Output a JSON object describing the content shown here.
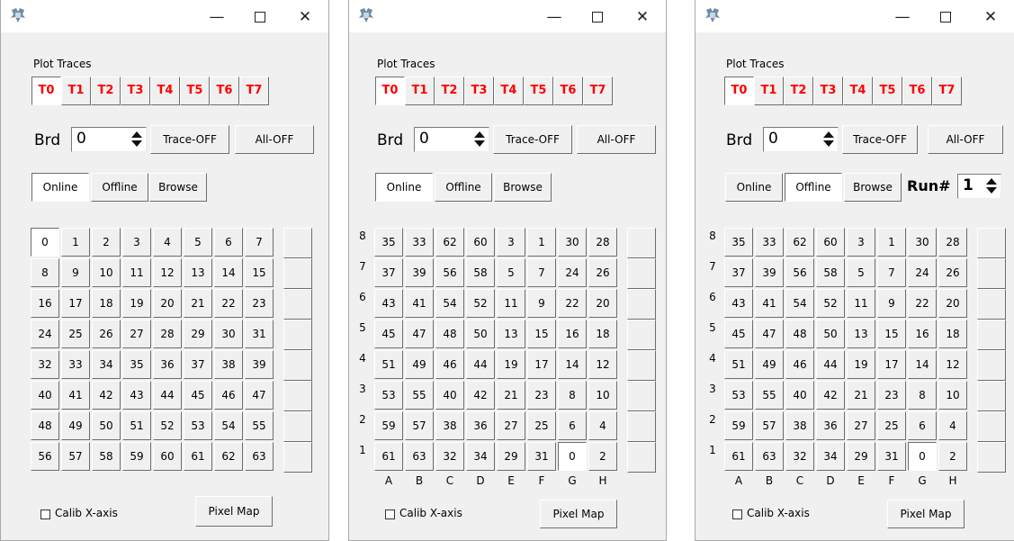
{
  "trace_section": {
    "label": "Plot Traces",
    "traces": [
      "T0",
      "T1",
      "T2",
      "T3",
      "T4",
      "T5",
      "T6",
      "T7"
    ],
    "selected": "T0"
  },
  "brd": {
    "label": "Brd",
    "value": "0"
  },
  "buttons": {
    "trace_off": "Trace-OFF",
    "all_off": "All-OFF",
    "pixel_map": "Pixel Map"
  },
  "modes": [
    "Online",
    "Offline",
    "Browse"
  ],
  "calib": {
    "label": "Calib X-axis",
    "checked": false
  },
  "run": {
    "label": "Run#",
    "value": "1"
  },
  "windows": [
    {
      "mode": "Online",
      "selected_channel": "0",
      "cells": [
        [
          "0",
          "1",
          "2",
          "3",
          "4",
          "5",
          "6",
          "7"
        ],
        [
          "8",
          "9",
          "10",
          "11",
          "12",
          "13",
          "14",
          "15"
        ],
        [
          "16",
          "17",
          "18",
          "19",
          "20",
          "21",
          "22",
          "23"
        ],
        [
          "24",
          "25",
          "26",
          "27",
          "28",
          "29",
          "30",
          "31"
        ],
        [
          "32",
          "33",
          "34",
          "35",
          "36",
          "37",
          "38",
          "39"
        ],
        [
          "40",
          "41",
          "42",
          "43",
          "44",
          "45",
          "46",
          "47"
        ],
        [
          "48",
          "49",
          "50",
          "51",
          "52",
          "53",
          "54",
          "55"
        ],
        [
          "56",
          "57",
          "58",
          "59",
          "60",
          "61",
          "62",
          "63"
        ]
      ]
    },
    {
      "mode": "Online",
      "selected_channel": "0",
      "row_labels": [
        "8",
        "7",
        "6",
        "5",
        "4",
        "3",
        "2",
        "1"
      ],
      "col_labels": [
        "A",
        "B",
        "C",
        "D",
        "E",
        "F",
        "G",
        "H"
      ],
      "cells": [
        [
          "35",
          "33",
          "62",
          "60",
          "3",
          "1",
          "30",
          "28"
        ],
        [
          "37",
          "39",
          "56",
          "58",
          "5",
          "7",
          "24",
          "26"
        ],
        [
          "43",
          "41",
          "54",
          "52",
          "11",
          "9",
          "22",
          "20"
        ],
        [
          "45",
          "47",
          "48",
          "50",
          "13",
          "15",
          "16",
          "18"
        ],
        [
          "51",
          "49",
          "46",
          "44",
          "19",
          "17",
          "14",
          "12"
        ],
        [
          "53",
          "55",
          "40",
          "42",
          "21",
          "23",
          "8",
          "10"
        ],
        [
          "59",
          "57",
          "38",
          "36",
          "27",
          "25",
          "6",
          "4"
        ],
        [
          "61",
          "63",
          "32",
          "34",
          "29",
          "31",
          "0",
          "2"
        ]
      ]
    },
    {
      "mode": "Offline",
      "selected_channel": "0",
      "row_labels": [
        "8",
        "7",
        "6",
        "5",
        "4",
        "3",
        "2",
        "1"
      ],
      "col_labels": [
        "A",
        "B",
        "C",
        "D",
        "E",
        "F",
        "G",
        "H"
      ],
      "cells": [
        [
          "35",
          "33",
          "62",
          "60",
          "3",
          "1",
          "30",
          "28"
        ],
        [
          "37",
          "39",
          "56",
          "58",
          "5",
          "7",
          "24",
          "26"
        ],
        [
          "43",
          "41",
          "54",
          "52",
          "11",
          "9",
          "22",
          "20"
        ],
        [
          "45",
          "47",
          "48",
          "50",
          "13",
          "15",
          "16",
          "18"
        ],
        [
          "51",
          "49",
          "46",
          "44",
          "19",
          "17",
          "14",
          "12"
        ],
        [
          "53",
          "55",
          "40",
          "42",
          "21",
          "23",
          "8",
          "10"
        ],
        [
          "59",
          "57",
          "38",
          "36",
          "27",
          "25",
          "6",
          "4"
        ],
        [
          "61",
          "63",
          "32",
          "34",
          "29",
          "31",
          "0",
          "2"
        ]
      ]
    }
  ]
}
